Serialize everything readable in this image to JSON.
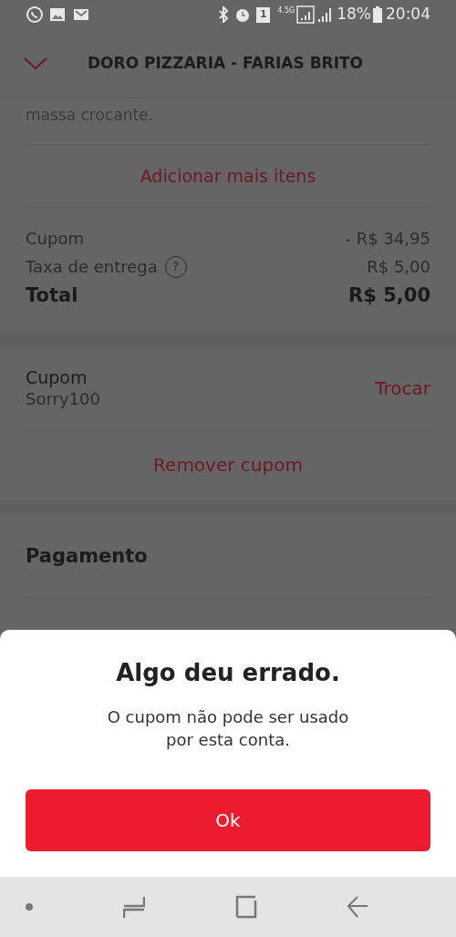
{
  "status_bar": {
    "sim": "1",
    "network": "4.5G",
    "battery": "18%",
    "time": "20:04"
  },
  "header": {
    "title": "DORO PIZZARIA - FARIAS BRITO"
  },
  "item_description": "massa crocante.",
  "add_more": "Adicionar mais itens",
  "summary": [
    {
      "label": "Cupom",
      "value": "- R$ 34,95",
      "kind": "line"
    },
    {
      "label": "Taxa de entrega",
      "value": "R$ 5,00",
      "help_icon": "?",
      "kind": "line"
    },
    {
      "label": "Total",
      "value": "R$ 5,00",
      "kind": "total"
    }
  ],
  "coupon": {
    "title": "Cupom",
    "code": "Sorry100",
    "change": "Trocar",
    "remove": "Remover cupom"
  },
  "payment": {
    "title": "Pagamento"
  },
  "dialog": {
    "title": "Algo deu errado.",
    "message": "O cupom não pode ser usado por esta conta.",
    "button": "Ok"
  }
}
